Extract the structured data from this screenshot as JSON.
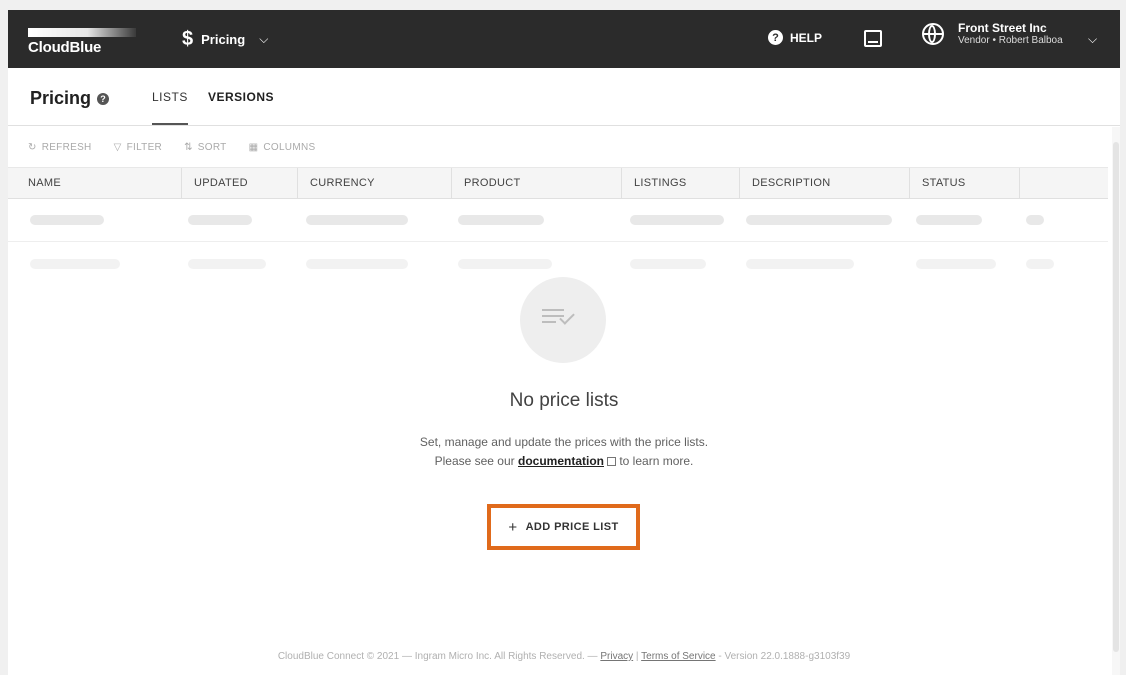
{
  "topbar": {
    "logo_text": "CloudBlue",
    "module_symbol": "$",
    "module_name": "Pricing",
    "help_label": "HELP",
    "account_name": "Front Street Inc",
    "account_sub": "Vendor • Robert Balboa"
  },
  "page": {
    "title": "Pricing",
    "tabs": [
      {
        "label": "LISTS",
        "active": true
      },
      {
        "label": "VERSIONS",
        "active": false
      }
    ]
  },
  "toolbar": {
    "refresh": "REFRESH",
    "filter": "FILTER",
    "sort": "SORT",
    "columns": "COLUMNS"
  },
  "table": {
    "columns": [
      "NAME",
      "UPDATED",
      "CURRENCY",
      "PRODUCT",
      "LISTINGS",
      "DESCRIPTION",
      "STATUS"
    ]
  },
  "empty": {
    "title": "No price lists",
    "line1": "Set, manage and update the prices with the price lists.",
    "line2_pre": "Please see our",
    "link": "documentation",
    "line2_post": "to learn more.",
    "button": "ADD PRICE LIST"
  },
  "footer": {
    "prefix": "CloudBlue Connect © 2021 — Ingram Micro Inc. All Rights Reserved. —",
    "privacy": "Privacy",
    "sep": "|",
    "terms": "Terms of Service",
    "version": "- Version 22.0.1888-g3103f39"
  },
  "colors": {
    "topbar": "#2b2b2b",
    "highlight": "#e06a1b"
  }
}
